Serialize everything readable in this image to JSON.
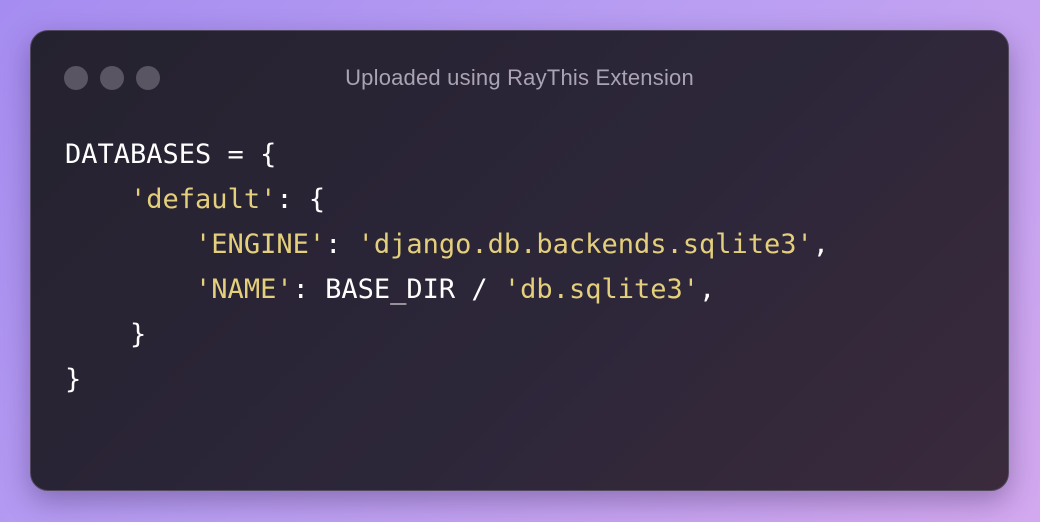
{
  "window": {
    "title": "Uploaded using RayThis Extension",
    "controls": [
      "close",
      "minimize",
      "maximize"
    ]
  },
  "code": {
    "language": "python",
    "lines": [
      [
        {
          "t": "DATABASES = {",
          "k": "plain"
        }
      ],
      [
        {
          "t": "    ",
          "k": "plain"
        },
        {
          "t": "'default'",
          "k": "str"
        },
        {
          "t": ": {",
          "k": "plain"
        }
      ],
      [
        {
          "t": "        ",
          "k": "plain"
        },
        {
          "t": "'ENGINE'",
          "k": "str"
        },
        {
          "t": ": ",
          "k": "plain"
        },
        {
          "t": "'django.db.backends.sqlite3'",
          "k": "str"
        },
        {
          "t": ",",
          "k": "plain"
        }
      ],
      [
        {
          "t": "        ",
          "k": "plain"
        },
        {
          "t": "'NAME'",
          "k": "str"
        },
        {
          "t": ": BASE_DIR / ",
          "k": "plain"
        },
        {
          "t": "'db.sqlite3'",
          "k": "str"
        },
        {
          "t": ",",
          "k": "plain"
        }
      ],
      [
        {
          "t": "    }",
          "k": "plain"
        }
      ],
      [
        {
          "t": "}",
          "k": "plain"
        }
      ]
    ]
  },
  "colors": {
    "background_gradient": [
      "#a58cf0",
      "#d3a8ef"
    ],
    "window_bg": "#2c2639",
    "text": "#ffffff",
    "string": "#e4cf7c",
    "title": "#a9a3b4",
    "window_dot": "#5a5563"
  }
}
